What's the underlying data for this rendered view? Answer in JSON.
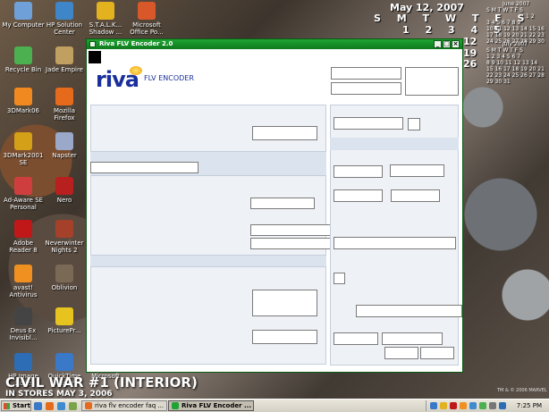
{
  "desktop": {
    "icons": [
      {
        "label": "My Computer",
        "color": "#6fa0d8"
      },
      {
        "label": "HP Solution Center",
        "color": "#3f86c9"
      },
      {
        "label": "S.T.A.L.K... Shadow ...",
        "color": "#e2b21f"
      },
      {
        "label": "Microsoft Office Po...",
        "color": "#d9582a"
      },
      {
        "label": "Recycle Bin",
        "color": "#4caf50"
      },
      {
        "label": "Jade Empire",
        "color": "#c0a060"
      },
      {
        "label": "3DMark06",
        "color": "#f08a20"
      },
      {
        "label": "Mozilla Firefox",
        "color": "#e56a1c"
      },
      {
        "label": "3DMark2001 SE",
        "color": "#d4a017"
      },
      {
        "label": "Napster",
        "color": "#9aa9c9"
      },
      {
        "label": "Ad-Aware SE Personal",
        "color": "#cf3e3e"
      },
      {
        "label": "Nero",
        "color": "#b82020"
      },
      {
        "label": "Adobe Reader 8",
        "color": "#c01818"
      },
      {
        "label": "Neverwinter Nights 2",
        "color": "#a5402a"
      },
      {
        "label": "avast! Antivirus",
        "color": "#f09020"
      },
      {
        "label": "Oblivion",
        "color": "#7a6a55"
      },
      {
        "label": "Deus Ex Invisibl...",
        "color": "#444444"
      },
      {
        "label": "PicturePr...",
        "color": "#e7c31f"
      },
      {
        "label": "HP Image Zone",
        "color": "#2c6db5"
      },
      {
        "label": "QuickTime Player",
        "color": "#3a78c8"
      },
      {
        "label": "Microsoft",
        "color": "#d9582a"
      }
    ],
    "big_calendar": {
      "date_label": "May 12, 2007",
      "weekdays": "S M T W T F S",
      "row1": "1 2 3 4 5",
      "side_numbers": [
        "12",
        "19",
        "26"
      ]
    },
    "small_calendars": [
      {
        "title": "June 2007",
        "lines": [
          "S M T W T F S",
          "1 2",
          "3 4 5 6 7 8 9",
          "10 11 12 13 14 15 16",
          "17 18 19 20 21 22 23",
          "24 25 26 27 28 29 30"
        ]
      },
      {
        "title": "July 2007",
        "lines": [
          "S M T W T F S",
          "1 2 3 4 5 6 7",
          "8 9 10 11 12 13 14",
          "15 16 17 18 19 20 21",
          "22 23 24 25 26 27 28",
          "29 30 31"
        ]
      }
    ],
    "banner_line1": "CIVIL WAR #1 (INTERIOR)",
    "banner_line2": "IN STORES MAY 3, 2006",
    "copyright": "TM & © 2006 MARVEL"
  },
  "window": {
    "title": "Riva FLV Encoder 2.0",
    "logo_brand": "riva",
    "logo_product": "FLV ENCODER"
  },
  "taskbar": {
    "start_label": "Start",
    "tasks": [
      {
        "label": "riva flv encoder faq ...",
        "active": false
      },
      {
        "label": "Riva FLV Encoder ...",
        "active": true
      }
    ],
    "clock": "7:25 PM"
  }
}
